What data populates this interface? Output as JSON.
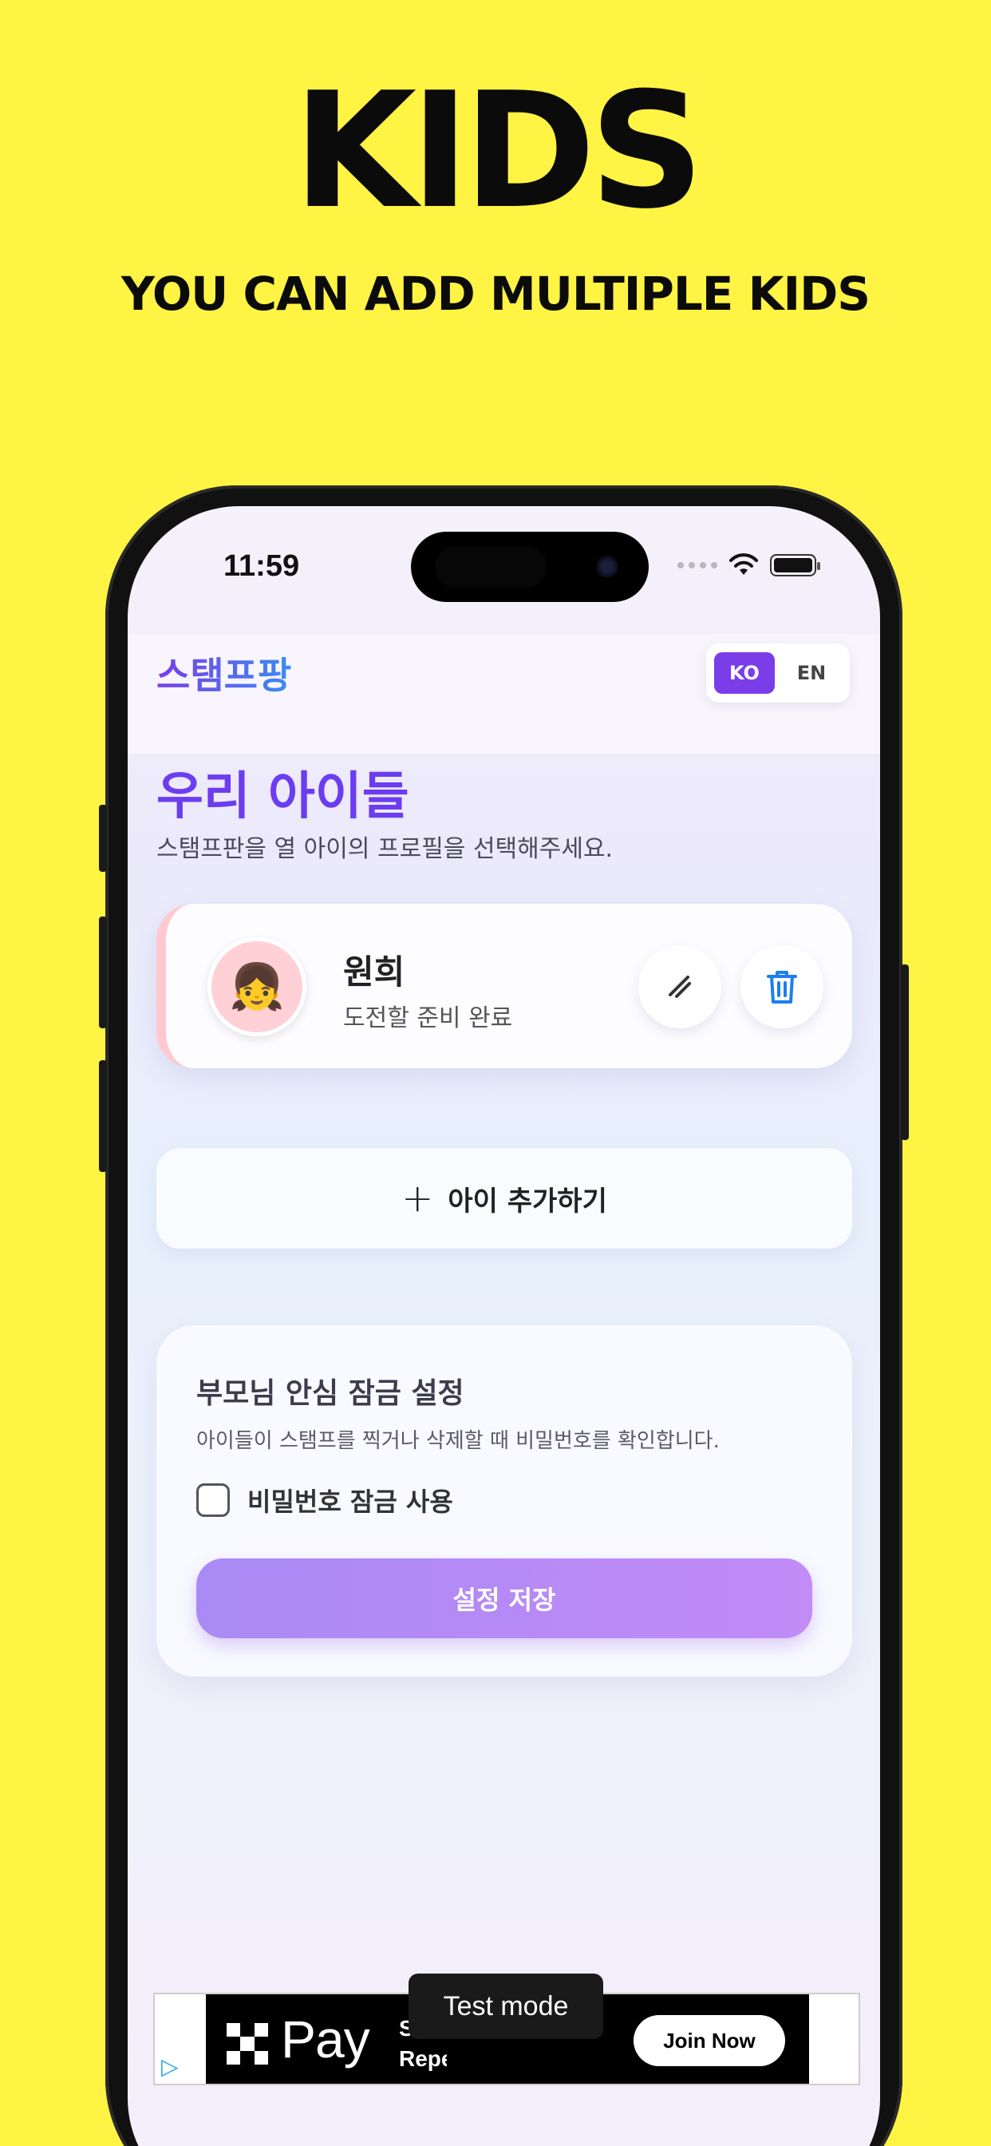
{
  "marketing": {
    "headline": "KIDS",
    "subheadline": "YOU CAN ADD MULTIPLE KIDS"
  },
  "status_bar": {
    "time": "11:59"
  },
  "app": {
    "brand": "스탬프팡",
    "languages": [
      "KO",
      "EN"
    ],
    "active_language": "KO"
  },
  "page": {
    "title": "우리 아이들",
    "subtitle": "스탬프판을 열 아이의 프로필을 선택해주세요."
  },
  "kids": [
    {
      "name": "원희",
      "status": "도전할 준비 완료",
      "avatar_emoji": "👧",
      "avatar_color": "#FFD0D6"
    }
  ],
  "add_kid": {
    "label": "아이 추가하기"
  },
  "parent_lock": {
    "title": "부모님 안심 잠금 설정",
    "description": "아이들이 스탬프를 찍거나 삭제할 때 비밀번호를 확인합니다.",
    "checkbox_label": "비밀번호 잠금 사용",
    "checkbox_checked": false,
    "save_label": "설정 저장"
  },
  "ad": {
    "brand": "Pay",
    "partial_text": "S... Repeat.",
    "cta": "Join Now",
    "test_mode_label": "Test mode"
  },
  "colors": {
    "background": "#FFF343",
    "accent": "#7A3DE8",
    "title": "#6C3DF0",
    "save_button": "#B48BF6"
  }
}
